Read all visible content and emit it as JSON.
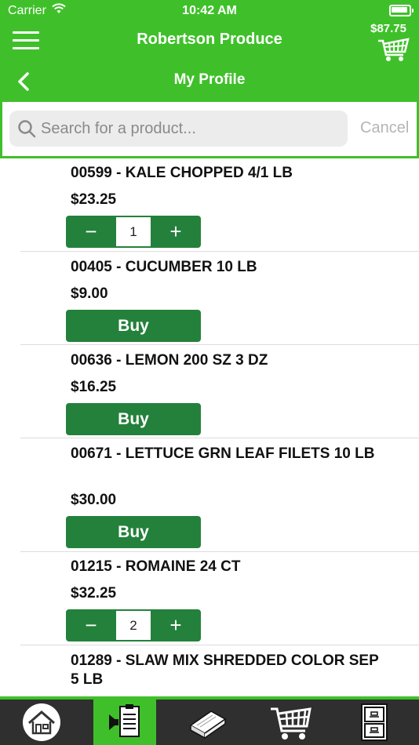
{
  "status_bar": {
    "carrier": "Carrier",
    "time": "10:42 AM"
  },
  "header": {
    "app_title": "Robertson Produce",
    "cart_total": "$87.75",
    "page_title": "My Profile"
  },
  "search": {
    "placeholder": "Search for a product...",
    "cancel_label": "Cancel"
  },
  "products": [
    {
      "name": "00599 - KALE CHOPPED 4/1 LB",
      "price": "$23.25",
      "control": "stepper",
      "qty": "1"
    },
    {
      "name": "00405 - CUCUMBER 10 LB",
      "price": "$9.00",
      "control": "buy",
      "buy_label": "Buy"
    },
    {
      "name": "00636 - LEMON 200 SZ 3 DZ",
      "price": "$16.25",
      "control": "buy",
      "buy_label": "Buy"
    },
    {
      "name": "00671 - LETTUCE GRN LEAF FILETS 10 LB",
      "price": "$30.00",
      "control": "buy",
      "buy_label": "Buy"
    },
    {
      "name": "01215 - ROMAINE 24 CT",
      "price": "$32.25",
      "control": "stepper",
      "qty": "2"
    },
    {
      "name": "01289 - SLAW MIX SHREDDED COLOR SEP 5 LB",
      "price": "",
      "control": "none"
    }
  ],
  "stepper_symbols": {
    "minus": "−",
    "plus": "+"
  },
  "tabs": [
    {
      "icon": "home-icon",
      "active": false
    },
    {
      "icon": "order-guide-icon",
      "active": true
    },
    {
      "icon": "catalog-book-icon",
      "active": false
    },
    {
      "icon": "shopping-cart-icon",
      "active": false
    },
    {
      "icon": "file-cabinet-icon",
      "active": false
    }
  ],
  "colors": {
    "brand_green": "#3fc02a",
    "button_green": "#23813b",
    "tabbar_dark": "#2f2f2f"
  }
}
